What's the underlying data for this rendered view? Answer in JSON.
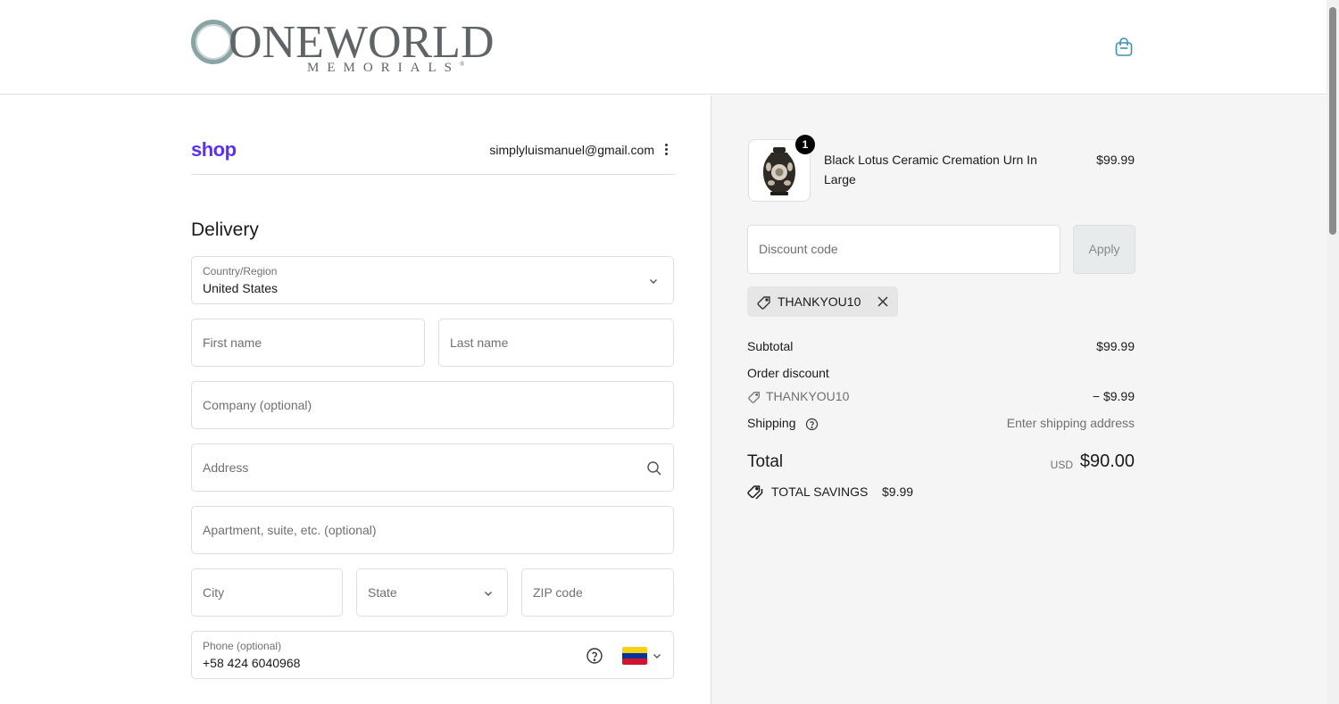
{
  "header": {
    "brand_main": "ONEWORLD",
    "brand_sub": "MEMORIALS",
    "brand_mark": "®",
    "cart_icon": "shopping-bag-icon"
  },
  "account": {
    "shop_label": "shop",
    "email": "simplyluismanuel@gmail.com",
    "menu_icon": "kebab-menu-icon"
  },
  "delivery": {
    "title": "Delivery",
    "country": {
      "label": "Country/Region",
      "value": "United States"
    },
    "first_name": {
      "placeholder": "First name"
    },
    "last_name": {
      "placeholder": "Last name"
    },
    "company": {
      "placeholder": "Company (optional)"
    },
    "address": {
      "placeholder": "Address",
      "icon": "search-icon"
    },
    "apartment": {
      "placeholder": "Apartment, suite, etc. (optional)"
    },
    "city": {
      "placeholder": "City"
    },
    "state": {
      "placeholder": "State"
    },
    "zip": {
      "placeholder": "ZIP code"
    },
    "phone": {
      "label": "Phone (optional)",
      "value": "+58 424 6040968",
      "country_flag": "venezuela-flag"
    }
  },
  "summary": {
    "item": {
      "quantity": "1",
      "name": "Black Lotus Ceramic Cremation Urn In Large",
      "price": "$99.99"
    },
    "discount": {
      "placeholder": "Discount code",
      "apply_label": "Apply",
      "applied_code": "THANKYOU10"
    },
    "subtotal_label": "Subtotal",
    "subtotal_value": "$99.99",
    "order_discount_label": "Order discount",
    "order_discount_code": "THANKYOU10",
    "order_discount_value": "− $9.99",
    "shipping_label": "Shipping",
    "shipping_value": "Enter shipping address",
    "total_label": "Total",
    "currency": "USD",
    "total_value": "$90.00",
    "savings_label": "TOTAL SAVINGS",
    "savings_value": "$9.99"
  },
  "colors": {
    "shop_brand": "#5a31f4",
    "summary_bg": "#f5f5f5",
    "accent_icon": "#3f8eb3"
  }
}
